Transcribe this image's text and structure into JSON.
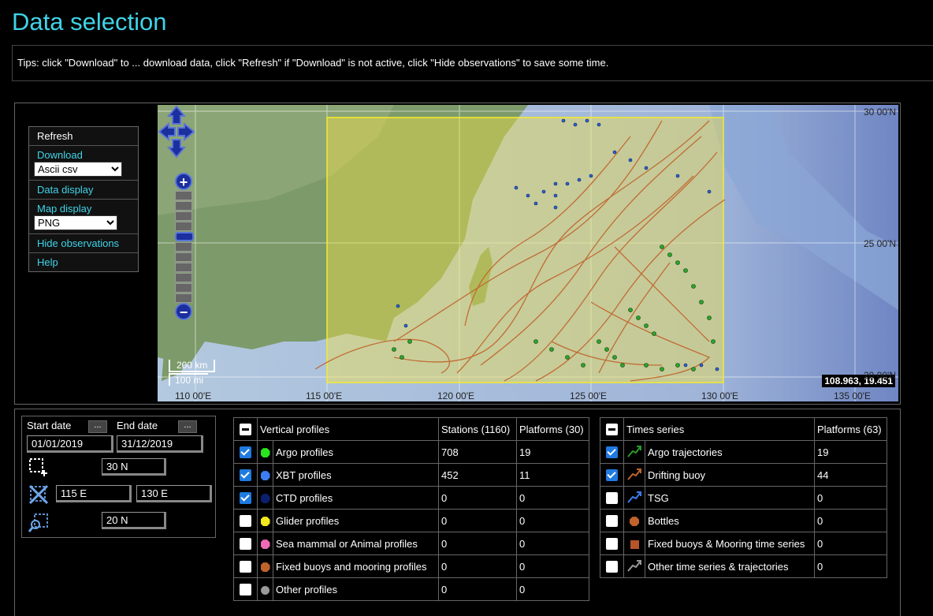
{
  "page": {
    "title": "Data selection",
    "tips": "Tips: click \"Download\" to ... download data, click \"Refresh\" if \"Download\" is not active, click \"Hide observations\" to save some time."
  },
  "menu": {
    "refresh": "Refresh",
    "download": "Download",
    "download_format": "Ascii csv",
    "data_display": "Data display",
    "map_display": "Map display",
    "map_format": "PNG",
    "hide_observations": "Hide observations",
    "help": "Help"
  },
  "map": {
    "lat_labels": [
      "30 00'N",
      "25 00'N",
      "20 00'N"
    ],
    "lon_labels": [
      "110 00'E",
      "115 00'E",
      "120 00'E",
      "125 00'E",
      "130 00'E",
      "135 00'E"
    ],
    "coords_readout": "108.963, 19.451",
    "scale_km": "200 km",
    "scale_mi": "100 mi",
    "selection_color": "#f2e24a",
    "trajectory_color": "#c0632b"
  },
  "dates": {
    "start_label": "Start date",
    "end_label": "End date",
    "picker_label": "...",
    "start_value": "01/01/2019",
    "end_value": "31/12/2019",
    "north": "30 N",
    "west": "115 E",
    "east": "130 E",
    "south": "20 N"
  },
  "profiles": {
    "header": "Vertical profiles",
    "stations_header": "Stations (1160)",
    "platforms_header": "Platforms (30)",
    "rows": [
      {
        "label": "Argo profiles",
        "stations": "708",
        "platforms": "19",
        "checked": true,
        "color": "#29e61e"
      },
      {
        "label": "XBT profiles",
        "stations": "452",
        "platforms": "11",
        "checked": true,
        "color": "#3b7df2"
      },
      {
        "label": "CTD profiles",
        "stations": "0",
        "platforms": "0",
        "checked": true,
        "color": "#0b1f6e"
      },
      {
        "label": "Glider profiles",
        "stations": "0",
        "platforms": "0",
        "checked": false,
        "color": "#f2e81d"
      },
      {
        "label": "Sea mammal or Animal profiles",
        "stations": "0",
        "platforms": "0",
        "checked": false,
        "color": "#f06ab5"
      },
      {
        "label": "Fixed buoys and mooring profiles",
        "stations": "0",
        "platforms": "0",
        "checked": false,
        "color": "#c0632b"
      },
      {
        "label": "Other profiles",
        "stations": "0",
        "platforms": "0",
        "checked": false,
        "color": "#999999"
      }
    ]
  },
  "timeseries": {
    "header": "Times series",
    "platforms_header": "Platforms (63)",
    "rows": [
      {
        "label": "Argo trajectories",
        "platforms": "19",
        "checked": true,
        "color": "#2a9a2a",
        "icon": "trajectory-icon"
      },
      {
        "label": "Drifting buoy",
        "platforms": "44",
        "checked": true,
        "color": "#c0632b",
        "icon": "trajectory-icon"
      },
      {
        "label": "TSG",
        "platforms": "0",
        "checked": false,
        "color": "#3b7df2",
        "icon": "trajectory-icon"
      },
      {
        "label": "Bottles",
        "platforms": "0",
        "checked": false,
        "color": "#c0632b",
        "icon": "octagon-icon"
      },
      {
        "label": "Fixed buoys & Mooring time series",
        "platforms": "0",
        "checked": false,
        "color": "#b5552a",
        "icon": "square-icon"
      },
      {
        "label": "Other time series & trajectories",
        "platforms": "0",
        "checked": false,
        "color": "#999999",
        "icon": "trajectory-icon"
      }
    ]
  }
}
